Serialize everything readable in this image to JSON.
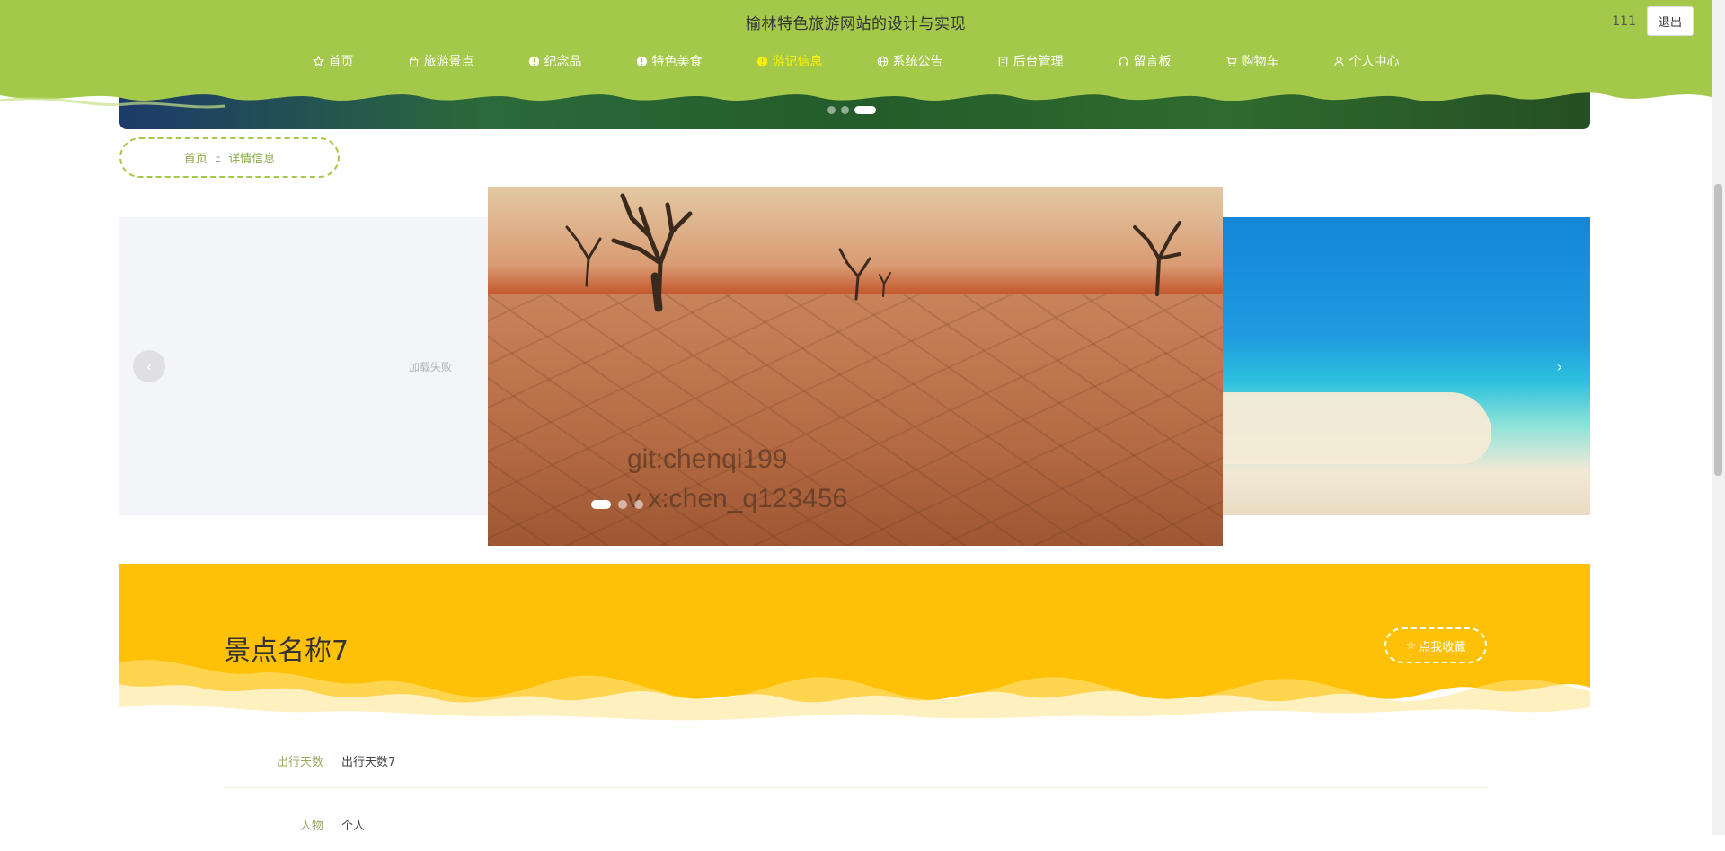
{
  "header": {
    "title": "榆林特色旅游网站的设计与实现",
    "username": "111",
    "logout_label": "退出",
    "accent_color": "#a4c94a",
    "active_color": "#fff200"
  },
  "nav": {
    "items": [
      {
        "label": "首页",
        "icon": "star-icon"
      },
      {
        "label": "旅游景点",
        "icon": "bag-icon"
      },
      {
        "label": "纪念品",
        "icon": "info-icon"
      },
      {
        "label": "特色美食",
        "icon": "info-icon"
      },
      {
        "label": "游记信息",
        "icon": "info-icon",
        "active": true
      },
      {
        "label": "系统公告",
        "icon": "globe-icon"
      },
      {
        "label": "后台管理",
        "icon": "building-icon"
      },
      {
        "label": "留言板",
        "icon": "headset-icon"
      },
      {
        "label": "购物车",
        "icon": "cart-icon"
      },
      {
        "label": "个人中心",
        "icon": "user-icon"
      }
    ]
  },
  "breadcrumb": {
    "home": "首页",
    "separator": "Ξ",
    "current": "详情信息"
  },
  "carousel": {
    "left_slide_text": "加载失败",
    "watermark_line1": "git:chenqi199",
    "watermark_line2": "v x:chen_q123456",
    "slide_count": 3,
    "active_index": 0,
    "prev_icon": "chevron-left-icon",
    "next_icon": "chevron-right-icon"
  },
  "detail": {
    "title": "景点名称7",
    "favorite_label": "点我收藏",
    "banner_color": "#ffc107",
    "fields": [
      {
        "label": "出行天数",
        "value": "出行天数7"
      },
      {
        "label": "人物",
        "value": "个人"
      }
    ]
  }
}
